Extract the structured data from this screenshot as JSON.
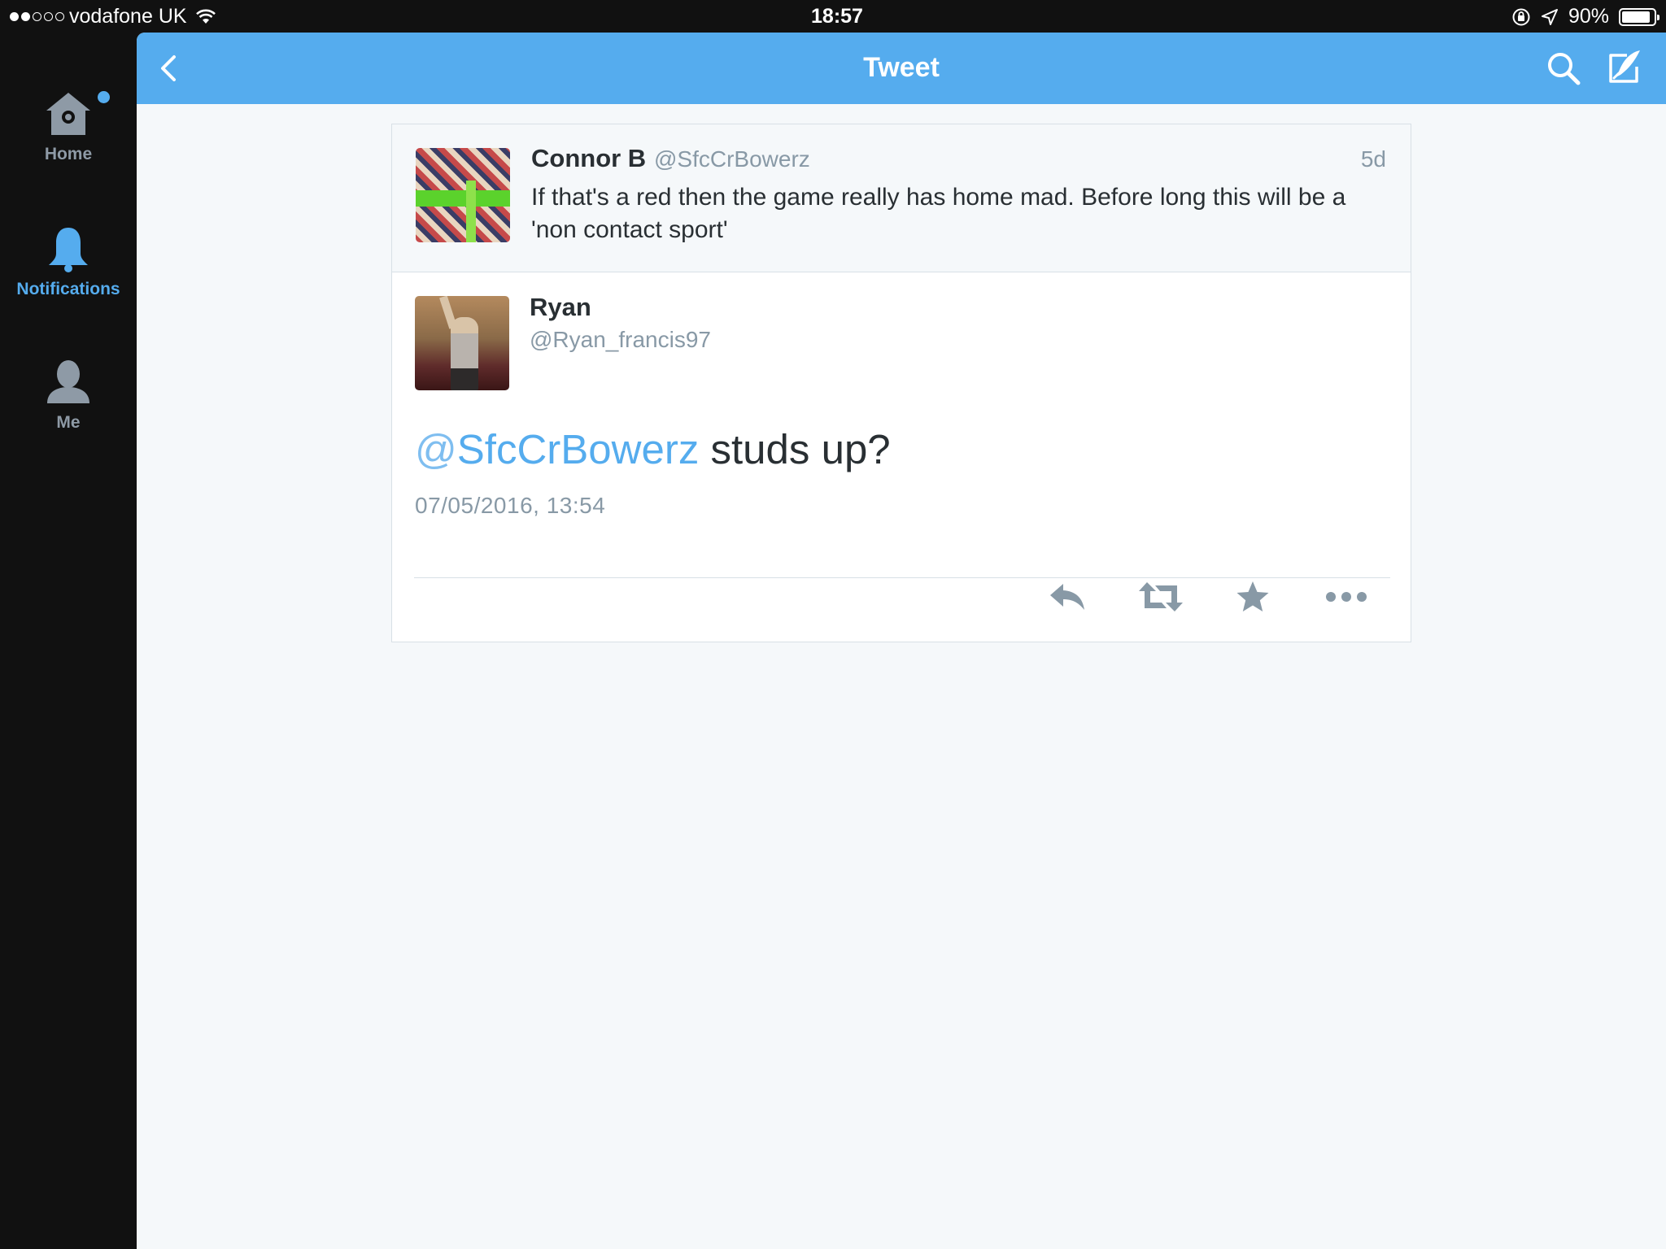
{
  "status_bar": {
    "carrier": "vodafone UK",
    "time": "18:57",
    "battery_percent": "90%",
    "battery_level": 0.9,
    "signal_bars_filled": 2,
    "signal_bars_total": 5
  },
  "sidebar": {
    "items": [
      {
        "label": "Home",
        "icon": "home-icon",
        "active": false,
        "has_badge": true
      },
      {
        "label": "Notifications",
        "icon": "bell-icon",
        "active": true
      },
      {
        "label": "Me",
        "icon": "person-icon",
        "active": false
      }
    ]
  },
  "navbar": {
    "title": "Tweet"
  },
  "parent_tweet": {
    "name": "Connor B",
    "handle": "@SfcCrBowerz",
    "time": "5d",
    "text": "If that's a red then the game really has home mad. Before long this will be a 'non contact sport'"
  },
  "main_tweet": {
    "name": "Ryan",
    "handle": "@Ryan_francis97",
    "mention_at": "@",
    "mention_name": "SfcCrBowerz",
    "text": " studs up?",
    "timestamp": "07/05/2016, 13:54"
  },
  "colors": {
    "accent": "#55acee",
    "text": "#292f33",
    "muted": "#8899a6",
    "icon_gray": "#8899a6"
  }
}
